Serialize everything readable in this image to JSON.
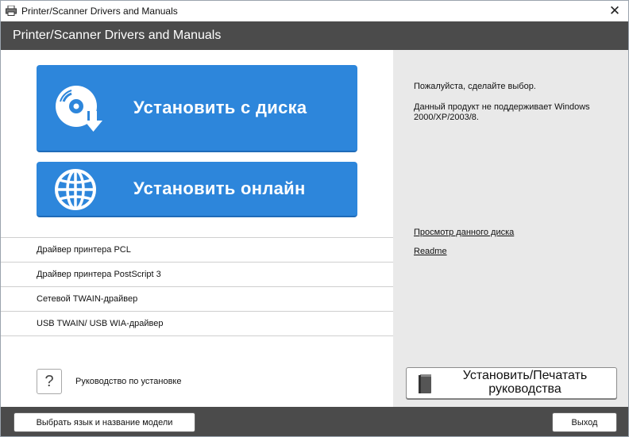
{
  "window": {
    "title": "Printer/Scanner Drivers and Manuals",
    "close_glyph": "✕"
  },
  "header": {
    "title": "Printer/Scanner Drivers and Manuals"
  },
  "main": {
    "install_disc": {
      "label": "Установить с диска",
      "icon": "disc-install-icon"
    },
    "install_online": {
      "label": "Установить онлайн",
      "icon": "globe-icon"
    },
    "drivers": [
      {
        "label": "Драйвер принтера PCL"
      },
      {
        "label": "Драйвер принтера PostScript 3"
      },
      {
        "label": "Сетевой TWAIN-драйвер"
      },
      {
        "label": "USB TWAIN/ USB WIA-драйвер"
      }
    ],
    "install_guide": {
      "icon_glyph": "?",
      "label": "Руководство по установке"
    }
  },
  "info": {
    "prompt": "Пожалуйста, сделайте выбор.",
    "not_supported": "Данный продукт не поддерживает Windows 2000/XP/2003/8.",
    "browse_link": "Просмотр данного диска",
    "readme_link": "Readme",
    "print_manual_button": "Установить/Печатать руководства"
  },
  "footer": {
    "select_language_button": "Выбрать язык и название модели",
    "exit_button": "Выход"
  },
  "colors": {
    "accent": "#2d86db",
    "header_bg": "#4b4b4b",
    "panel_bg": "#e9e9e9"
  }
}
